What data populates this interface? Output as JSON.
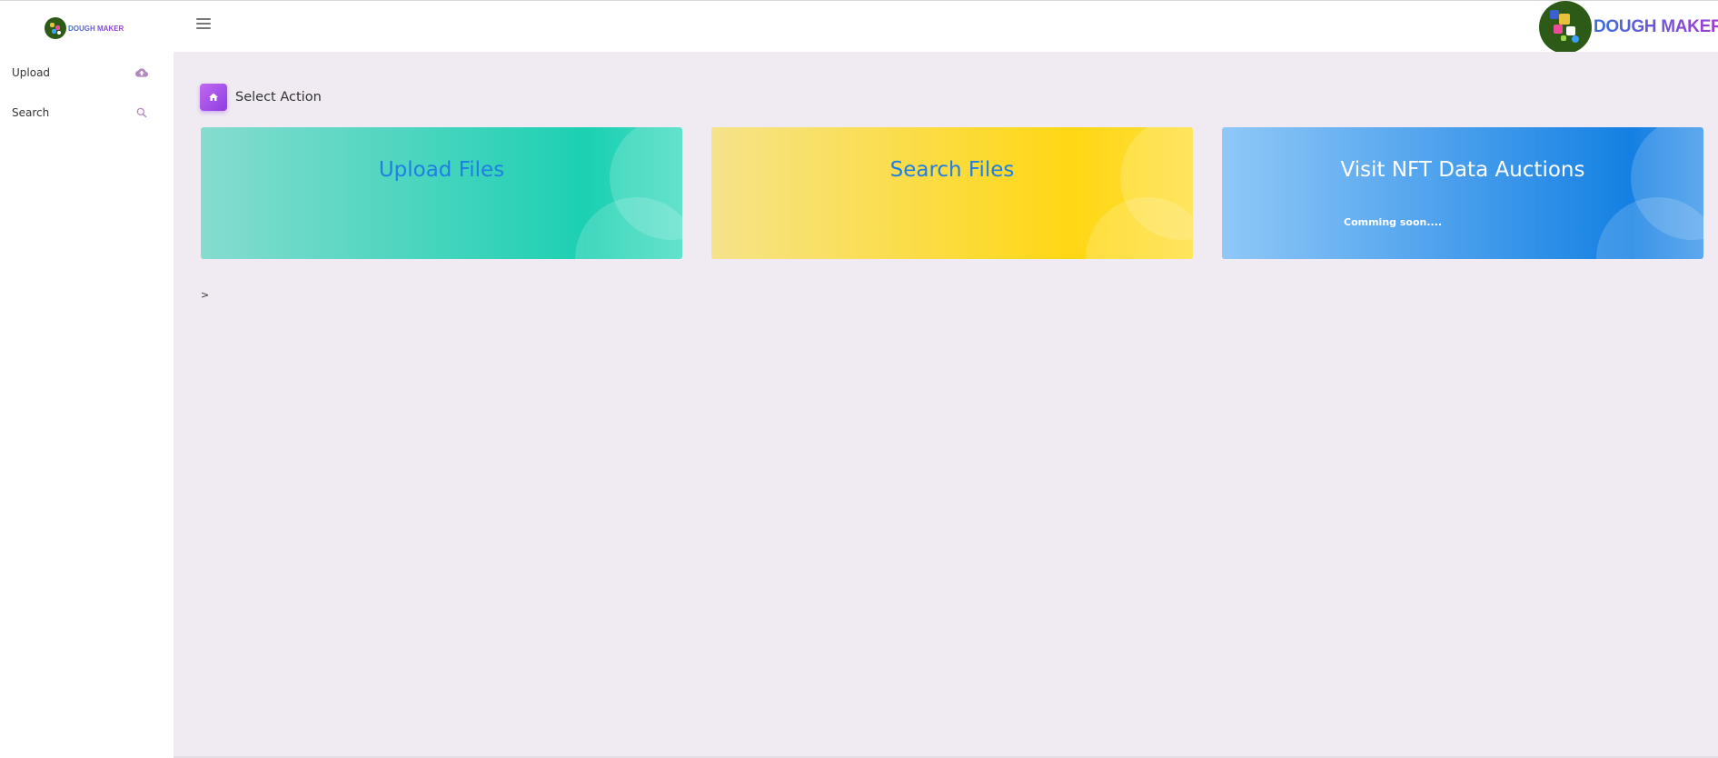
{
  "sidebar": {
    "logo_text": "DOUGH MAKER",
    "items": [
      {
        "label": "Upload",
        "icon": "cloud-upload-icon"
      },
      {
        "label": "Search",
        "icon": "search-icon"
      }
    ]
  },
  "header": {
    "brand_text": "DOUGH MAKER",
    "menu_icon": "hamburger-menu-icon"
  },
  "main": {
    "page_title": "Select Action",
    "page_icon": "home-icon",
    "cards": [
      {
        "title": "Upload Files",
        "subtitle": ""
      },
      {
        "title": "Search Files",
        "subtitle": ""
      },
      {
        "title": "Visit NFT Data Auctions",
        "subtitle": "Comming soon...."
      }
    ],
    "prompt_text": ">"
  },
  "colors": {
    "accent_purple": "#9b47e6",
    "upload_card": "#1cd0b2",
    "search_card": "#ffd714",
    "nft_card": "#1480e3",
    "background": "#f0eaf2"
  }
}
